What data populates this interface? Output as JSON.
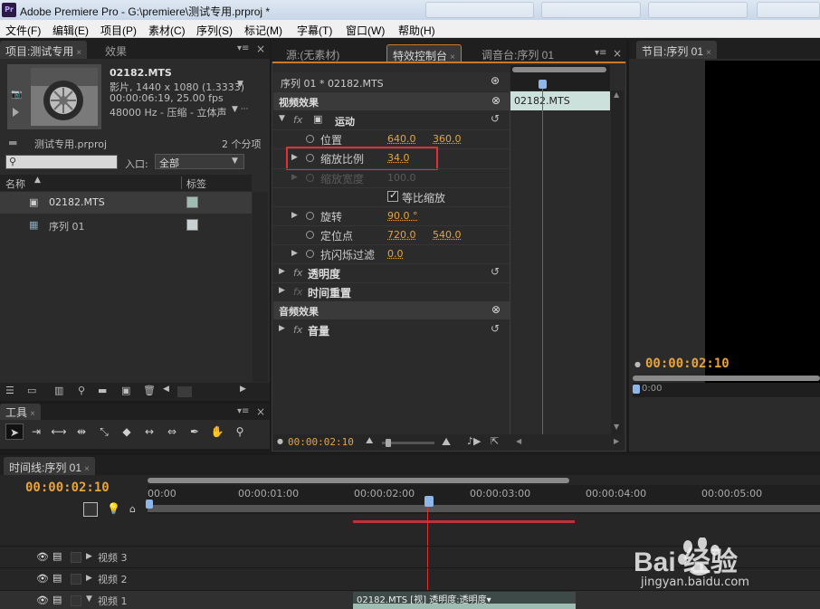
{
  "window": {
    "title": "Adobe Premiere Pro - G:\\premiere\\测试专用.prproj *",
    "logo_text": "Pr"
  },
  "menu": [
    "文件(F)",
    "编辑(E)",
    "项目(P)",
    "素材(C)",
    "序列(S)",
    "标记(M)",
    "字幕(T)",
    "窗口(W)",
    "帮助(H)"
  ],
  "project_panel": {
    "tabs": [
      "项目:测试专用",
      "效果"
    ],
    "clip": {
      "name": "02182.MTS",
      "line1": "影片, 1440 x 1080 (1.3333)",
      "line2": "00:00:06:19, 25.00 fps",
      "line3": "48000 Hz - 压缩 - 立体声"
    },
    "project_file": "测试专用.prproj",
    "item_count": "2 个分项",
    "search_placeholder": "",
    "entry_label": "入口:",
    "entry_value": "全部",
    "col_name": "名称",
    "col_label": "标签",
    "items": [
      {
        "name": "02182.MTS",
        "label_color": "#9fbcb3"
      },
      {
        "name": "序列 01",
        "label_color": "#c8d2d2"
      }
    ]
  },
  "tools_panel": {
    "title": "工具",
    "tools": [
      "selection-icon",
      "track-select-icon",
      "ripple-edit-icon",
      "rolling-edit-icon",
      "rate-stretch-icon",
      "razor-icon",
      "slip-icon",
      "slide-icon",
      "pen-icon",
      "hand-icon",
      "zoom-icon"
    ]
  },
  "effect_controls": {
    "tabs": [
      "源:(无素材)",
      "特效控制台",
      "调音台:序列 01"
    ],
    "header": "序列 01 * 02182.MTS",
    "clip_name": "02182.MTS",
    "video_effects": "视频效果",
    "motion": "运动",
    "position_label": "位置",
    "position_x": "640.0",
    "position_y": "360.0",
    "scale_label": "缩放比例",
    "scale_value": "34.0",
    "scale_width_label": "缩放宽度",
    "scale_width_value": "100.0",
    "uniform_scale": "等比缩放",
    "uniform_scale_checked": true,
    "rotation_label": "旋转",
    "rotation_value": "90.0 °",
    "anchor_label": "定位点",
    "anchor_x": "720.0",
    "anchor_y": "540.0",
    "antiflicker_label": "抗闪烁过滤",
    "antiflicker_value": "0.0",
    "opacity": "透明度",
    "time_remap": "时间重置",
    "audio_effects": "音频效果",
    "volume": "音量",
    "timecode": "00:00:02:10",
    "highlight_color": "#e03030"
  },
  "program_panel": {
    "tab": "节目:序列 01",
    "timecode": "00:00:02:10",
    "ruler_start": "0:00"
  },
  "timeline": {
    "tab": "时间线:序列 01",
    "timecode": "00:00:02:10",
    "ruler": [
      "00:00",
      "00:00:01:00",
      "00:00:02:00",
      "00:00:03:00",
      "00:00:04:00",
      "00:00:05:00"
    ],
    "tracks": [
      "视频 3",
      "视频 2",
      "视频 1"
    ],
    "clip_label": "02182.MTS [视] 透明度:透明度▾",
    "clip_color": "#9fbcb3"
  },
  "watermark": {
    "brand": "Bai 经验",
    "url": "jingyan.baidu.com"
  }
}
